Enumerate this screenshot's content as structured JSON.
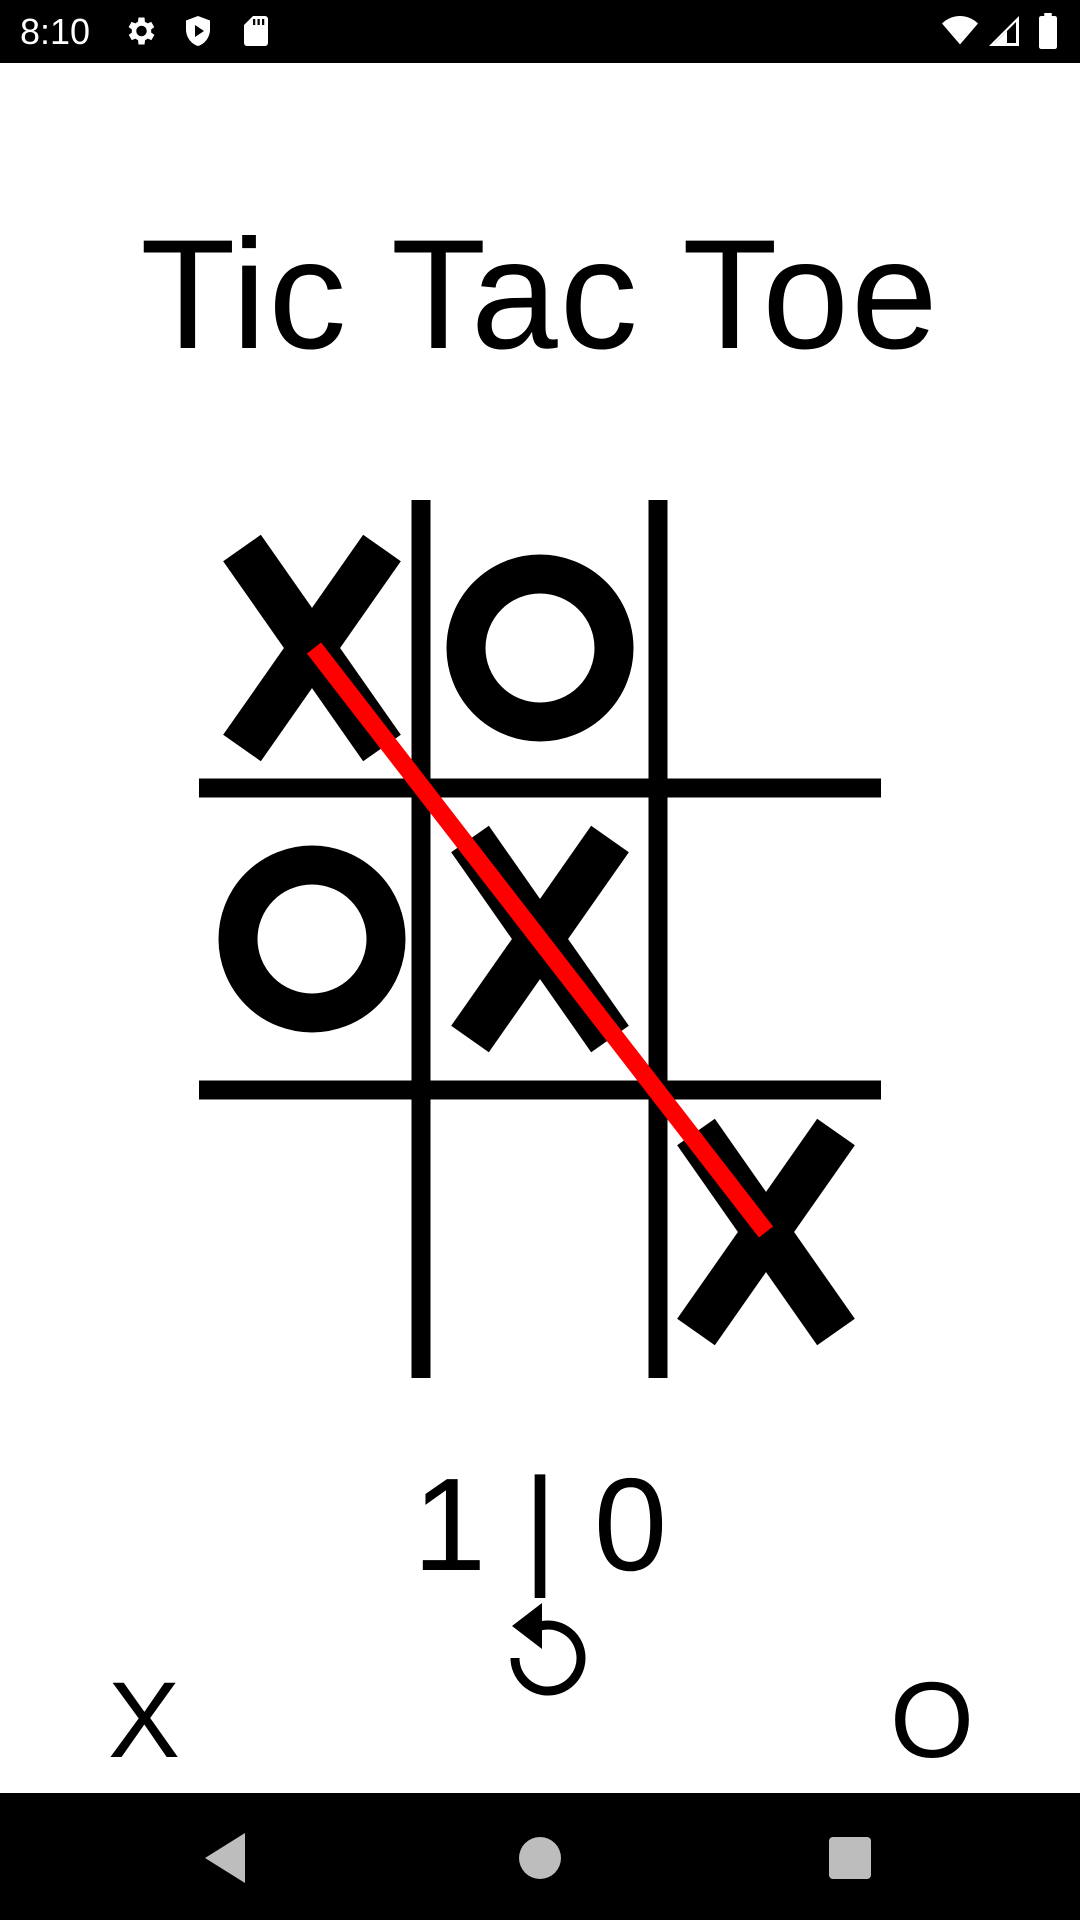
{
  "status_bar": {
    "time": "8:10",
    "icons_left": [
      "gear-icon",
      "shield-play-icon",
      "sd-card-icon"
    ],
    "icons_right": [
      "wifi-icon",
      "signal-icon",
      "battery-icon"
    ]
  },
  "title": "Tic Tac Toe",
  "board": {
    "cells": [
      [
        "X",
        "O",
        ""
      ],
      [
        "O",
        "X",
        ""
      ],
      [
        "",
        "",
        "X"
      ]
    ],
    "winning_line": {
      "from": [
        0,
        0
      ],
      "to": [
        2,
        2
      ],
      "color": "#ff0000"
    },
    "mark_color": "#000000"
  },
  "score": {
    "text": "1 | 0",
    "x": 1,
    "o": 0
  },
  "players": {
    "left": "X",
    "right": "O"
  },
  "controls": {
    "reset_icon": "replay-icon"
  },
  "nav_bar": {
    "buttons": [
      "back-icon",
      "home-icon",
      "recents-icon"
    ]
  }
}
